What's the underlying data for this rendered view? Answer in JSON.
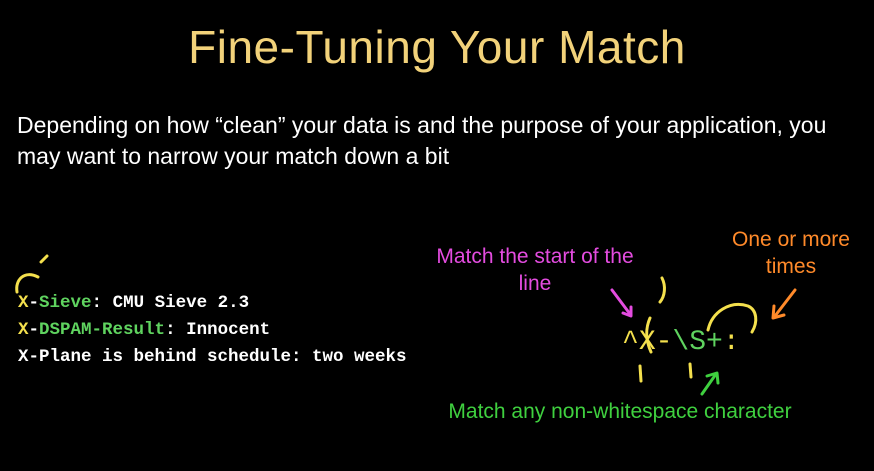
{
  "slide": {
    "title": "Fine-Tuning Your Match",
    "intro": "Depending on how “clean” your data is and the purpose of your application, you may want to narrow your match down a bit"
  },
  "code_lines": [
    {
      "key": "X-Sieve",
      "sep": ":",
      "value": " CMU Sieve 2.3"
    },
    {
      "key": "X-DSPAM-Result",
      "sep": ":",
      "value": " Innocent"
    },
    {
      "text": "X-Plane is behind schedule: two weeks"
    }
  ],
  "regex": {
    "caret": "^",
    "literal": "X-",
    "class": "\\S",
    "plus": "+",
    "colon": ":"
  },
  "annotations": {
    "line_start": "Match the start of the line",
    "one_or_more": "One or more times",
    "non_whitespace": "Match any non-whitespace character"
  },
  "colors": {
    "background": "#000000",
    "title": "#f2d27a",
    "key_yellow": "#f4e04d",
    "key_green": "#5fd35f",
    "annotation_pink": "#e44ce0",
    "annotation_orange": "#ff8a2a",
    "annotation_green": "#3fd03f"
  }
}
